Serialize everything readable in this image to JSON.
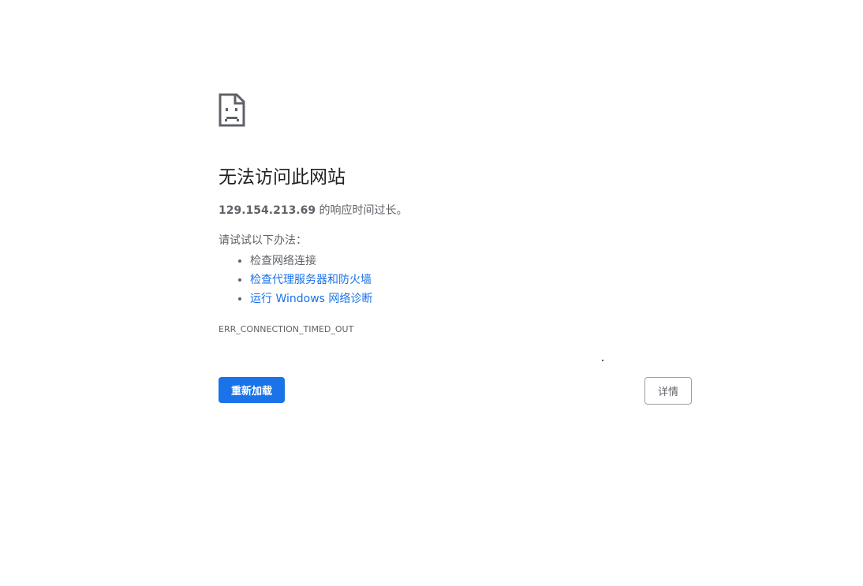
{
  "icon": "sad-page-icon",
  "heading": "无法访问此网站",
  "summary": {
    "host": "129.154.213.69",
    "message": " 的响应时间过长。"
  },
  "suggestions": {
    "label": "请试试以下办法：",
    "items": [
      {
        "text": "检查网络连接",
        "is_link": false
      },
      {
        "text": "检查代理服务器和防火墙",
        "is_link": true
      },
      {
        "text": "运行 Windows 网络诊断",
        "is_link": true
      }
    ]
  },
  "error_code": "ERR_CONNECTION_TIMED_OUT",
  "buttons": {
    "reload_label": "重新加载",
    "details_label": "详情"
  },
  "colors": {
    "primary": "#1a73e8",
    "text": "#5f6368",
    "heading": "#202124"
  }
}
